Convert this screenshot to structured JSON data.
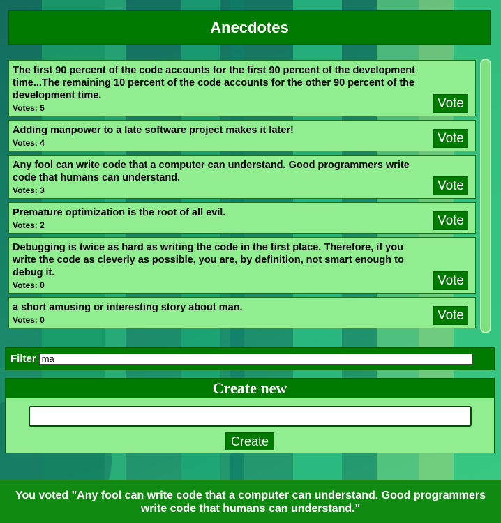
{
  "header": {
    "title": "Anecdotes"
  },
  "anecdotes": [
    {
      "text": "The first 90 percent of the code accounts for the first 90 percent of the development time...The remaining 10 percent of the code accounts for the other 90 percent of the development time.",
      "votes_label": "Votes: 5",
      "vote_label": "Vote"
    },
    {
      "text": "Adding manpower to a late software project makes it later!",
      "votes_label": "Votes: 4",
      "vote_label": "Vote"
    },
    {
      "text": "Any fool can write code that a computer can understand. Good programmers write code that humans can understand.",
      "votes_label": "Votes: 3",
      "vote_label": "Vote"
    },
    {
      "text": "Premature optimization is the root of all evil.",
      "votes_label": "Votes: 2",
      "vote_label": "Vote"
    },
    {
      "text": "Debugging is twice as hard as writing the code in the first place. Therefore, if you write the code as cleverly as possible, you are, by definition, not smart enough to debug it.",
      "votes_label": "Votes: 0",
      "vote_label": "Vote"
    },
    {
      "text": "a short amusing or interesting story about man.",
      "votes_label": "Votes: 0",
      "vote_label": "Vote"
    }
  ],
  "filter": {
    "label": "Filter",
    "value": "ma"
  },
  "create": {
    "title": "Create new",
    "input_value": "",
    "button_label": "Create"
  },
  "notification": {
    "text": "You voted \"Any fool can write code that a computer can understand. Good programmers write code that humans can understand.\""
  },
  "colors": {
    "header_bg": "#007a00",
    "item_bg": "#90ee90",
    "button_bg": "#007a00",
    "notification_bg": "#118a11"
  }
}
